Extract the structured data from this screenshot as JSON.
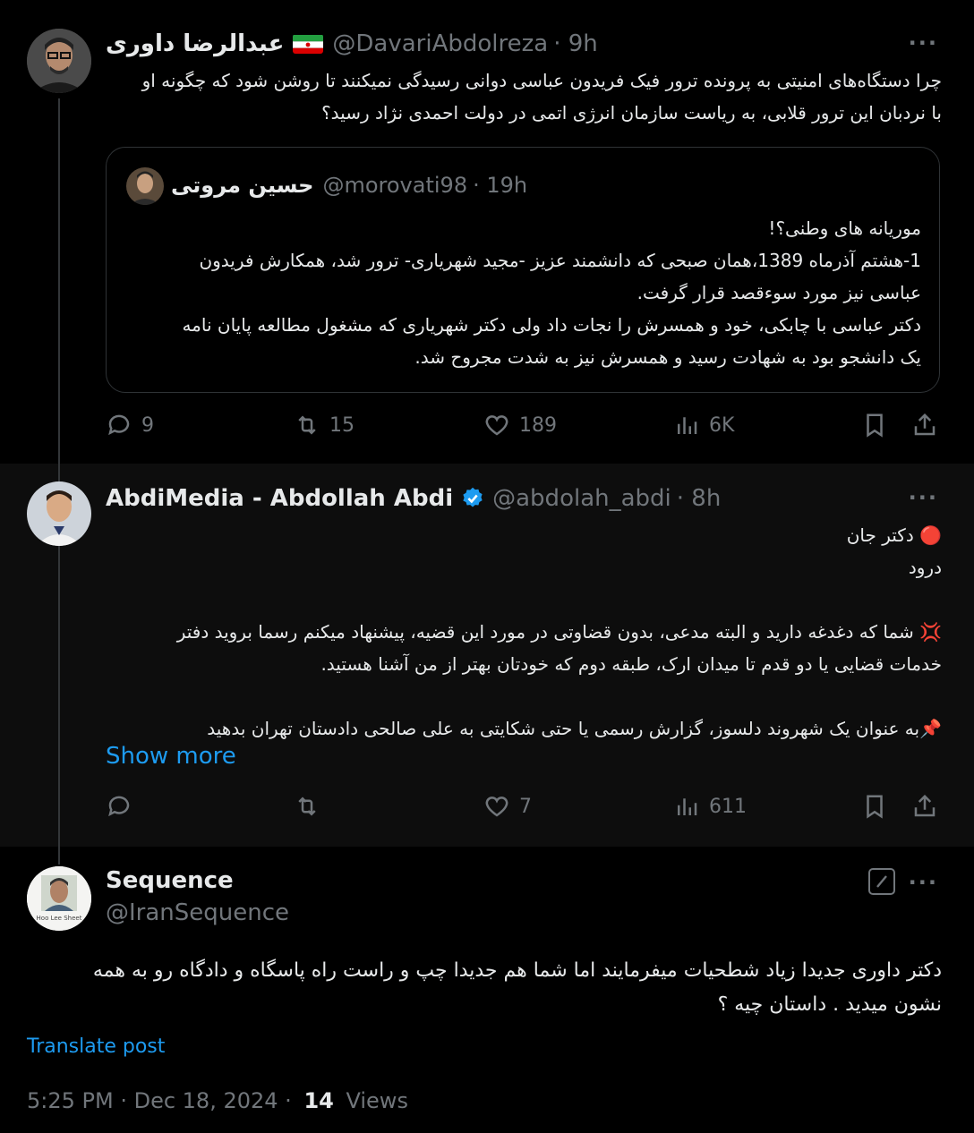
{
  "tweet1": {
    "name": "عبدالرضا داوری",
    "handle": "@DavariAbdolreza",
    "time": "· 9h",
    "more": "···",
    "text_line1": "چرا دستگاه‌های امنیتی به پرونده ترور فیک فریدون عباسی دوانی رسیدگی نمیکنند تا روشن شود که چگونه او",
    "text_line2": "با نردبان این ترور قلابی، به ریاست سازمان انرژی اتمی در دولت احمدی نژاد رسید؟",
    "quote": {
      "name": "حسین مروتی",
      "handle": "@morovati98",
      "time": "· 19h",
      "lines": [
        "موریانه های وطنی؟!",
        "1-هشتم آذرماه 1389،همان صبحی که دانشمند عزیز -مجید شهریاری- ترور شد، همکارش فریدون",
        "عباسی نیز مورد سوءقصد قرار گرفت.",
        "دکتر عباسی با چابکی، خود و همسرش را نجات داد ولی دکتر شهریاری که مشغول مطالعه پایان نامه",
        "یک دانشجو بود به شهادت رسید و همسرش نیز به شدت مجروح شد."
      ]
    },
    "actions": {
      "replies": "9",
      "reposts": "15",
      "likes": "189",
      "views": "6K"
    }
  },
  "tweet2": {
    "name": "AbdiMedia - Abdollah Abdi",
    "handle": "@abdolah_abdi",
    "time": "· 8h",
    "more": "···",
    "lines": [
      "🔴 دکتر جان",
      "درود",
      "💢 شما که دغدغه دارید و البته مدعی، بدون قضاوتی در مورد این قضیه، پیشنهاد میکنم رسما بروید دفتر",
      "خدمات قضایی یا دو قدم تا میدان ارک، طبقه دوم که خودتان بهتر از من آشنا هستید.",
      "📌به عنوان یک شهروند دلسوز، گزارش رسمی یا حتی شکایتی به علی صالحی دادستان تهران بدهید"
    ],
    "show_more": "Show more",
    "actions": {
      "replies": "",
      "reposts": "",
      "likes": "7",
      "views": "611"
    }
  },
  "tweet3": {
    "name": "Sequence",
    "handle": "@IranSequence",
    "more": "···",
    "avatar_caption": "Hoo Lee Sheet",
    "text_line1": "دکتر داوری جدیدا زیاد شطحیات میفرمایند اما شما هم جدیدا چپ و راست راه پاسگاه و دادگاه رو به همه",
    "text_line2": "نشون میدید . داستان چیه ؟",
    "translate": "Translate post",
    "timestamp": "5:25 PM · Dec 18, 2024 ·",
    "views_count": "14",
    "views_label": "Views"
  },
  "colors": {
    "accent": "#1d9bf0",
    "muted": "#71767b",
    "border": "#2f3336"
  }
}
